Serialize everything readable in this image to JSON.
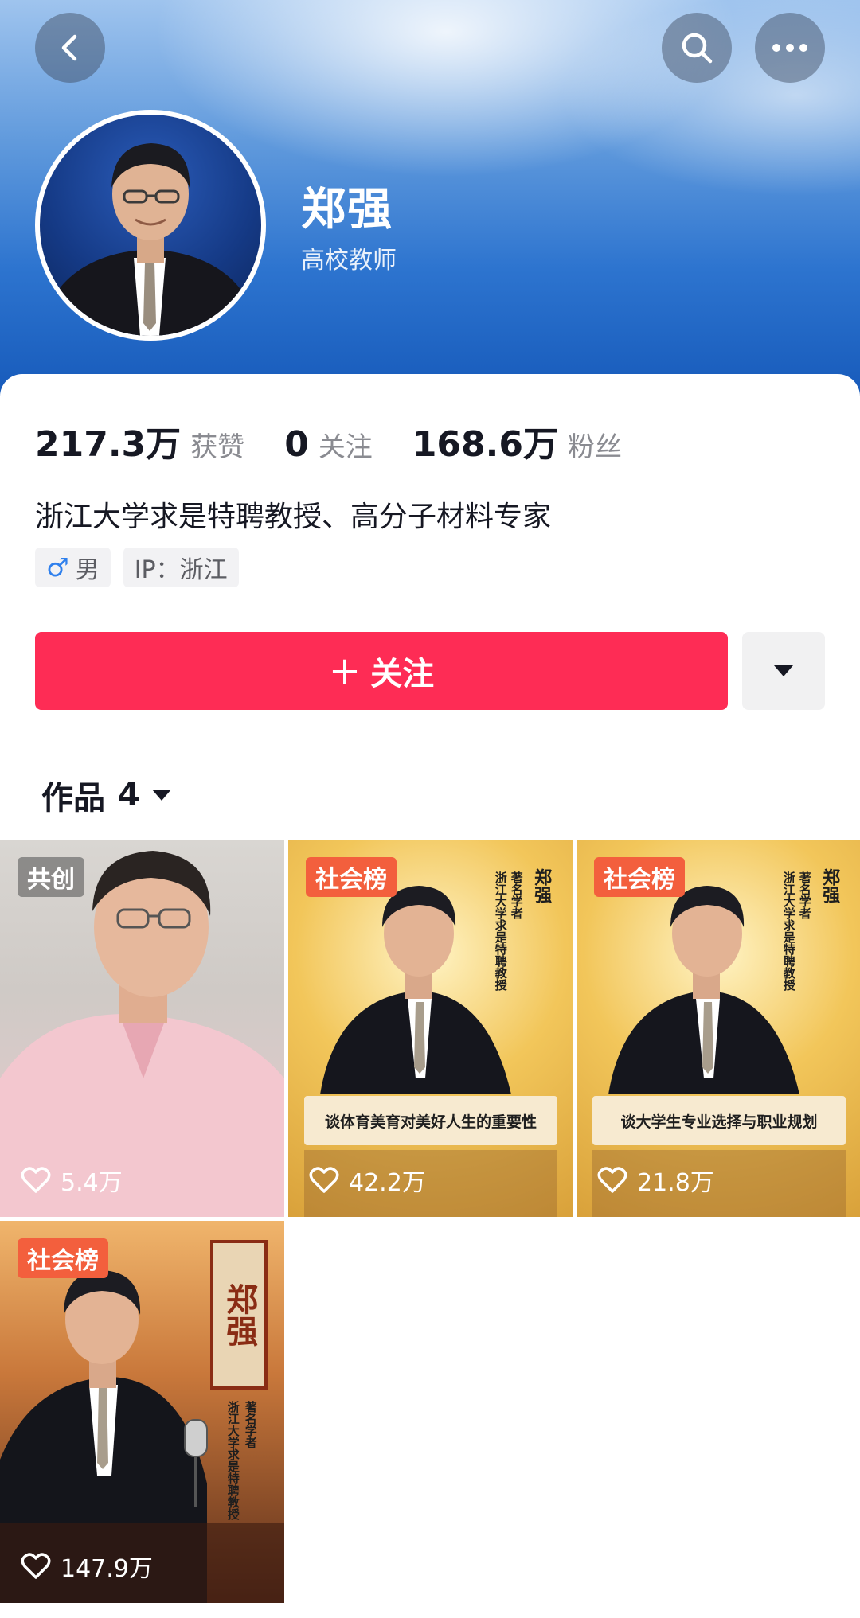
{
  "header": {
    "back_icon": "back-chevron-icon",
    "search_icon": "search-icon",
    "more_icon": "more-dots-icon"
  },
  "profile": {
    "name": "郑强",
    "role": "高校教师",
    "stats": [
      {
        "value": "217.3万",
        "label": "获赞"
      },
      {
        "value": "0",
        "label": "关注"
      },
      {
        "value": "168.6万",
        "label": "粉丝"
      }
    ],
    "bio": "浙江大学求是特聘教授、高分子材料专家",
    "tags": {
      "gender": "男",
      "gender_icon": "male-icon",
      "ip": "IP：浙江"
    }
  },
  "actions": {
    "follow_label": "关注",
    "follow_icon": "plus-icon",
    "dropdown_icon": "caret-down-icon"
  },
  "colors": {
    "accent": "#fe2c55",
    "badge_orange": "#f35f3d",
    "header_blue": "#1457b8"
  },
  "works": {
    "label": "作品",
    "count": "4",
    "items": [
      {
        "badge": "共创",
        "likes": "5.4万"
      },
      {
        "badge": "社会榜",
        "likes": "42.2万",
        "caption": "谈体育美育对美好人生的重要性",
        "side_text": "浙江大学求是特聘教授",
        "side_title": "著名学者",
        "name_vertical": "郑强"
      },
      {
        "badge": "社会榜",
        "likes": "21.8万",
        "caption": "谈大学生专业选择与职业规划",
        "side_text": "浙江大学求是特聘教授",
        "side_title": "著名学者",
        "name_vertical": "郑强"
      },
      {
        "badge": "社会榜",
        "likes": "147.9万",
        "name_vertical": "郑强",
        "side_title": "著名学者",
        "side_text": "浙江大学求是特聘教授"
      }
    ]
  }
}
